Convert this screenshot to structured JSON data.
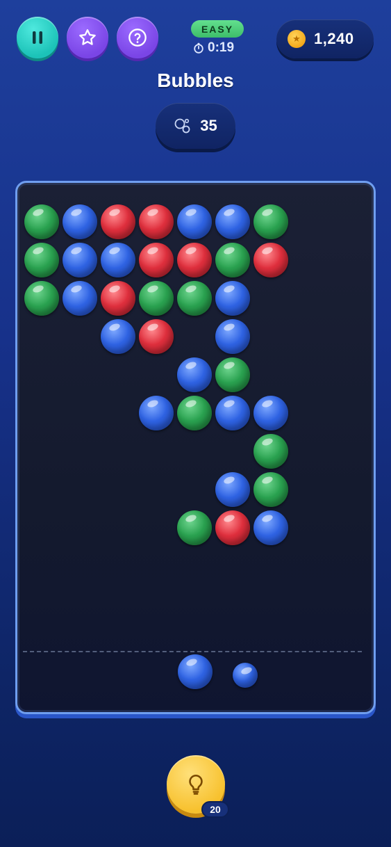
{
  "header": {
    "pause_icon": "pause-icon",
    "star_icon": "star-icon",
    "help_icon": "help-icon",
    "difficulty": "EASY",
    "timer": "0:19",
    "coins": "1,240"
  },
  "game": {
    "title": "Bubbles",
    "bubbles_remaining": "35"
  },
  "colors": {
    "green": "#2aa250",
    "blue": "#2f63e3",
    "red": "#df2f3d"
  },
  "board": {
    "rows": [
      [
        "green",
        "blue",
        "red",
        "red",
        "blue",
        "blue",
        "green",
        null,
        null
      ],
      [
        "green",
        "blue",
        "blue",
        "red",
        "red",
        "green",
        "red",
        null,
        null
      ],
      [
        "green",
        "blue",
        "red",
        "green",
        "green",
        "blue",
        null,
        null,
        null
      ],
      [
        null,
        null,
        "blue",
        "red",
        null,
        "blue",
        null,
        null,
        null
      ],
      [
        null,
        null,
        null,
        null,
        "blue",
        "green",
        null,
        null,
        null
      ],
      [
        null,
        null,
        null,
        "blue",
        "green",
        "blue",
        "blue",
        null,
        null
      ],
      [
        null,
        null,
        null,
        null,
        null,
        null,
        "green",
        null,
        null
      ],
      [
        null,
        null,
        null,
        null,
        null,
        "blue",
        "green",
        null,
        null
      ],
      [
        null,
        null,
        null,
        null,
        "green",
        "red",
        "blue",
        null,
        null
      ]
    ],
    "current_shot": "blue",
    "next_shot": "blue"
  },
  "hint": {
    "icon": "lightbulb-icon",
    "count": "20"
  }
}
